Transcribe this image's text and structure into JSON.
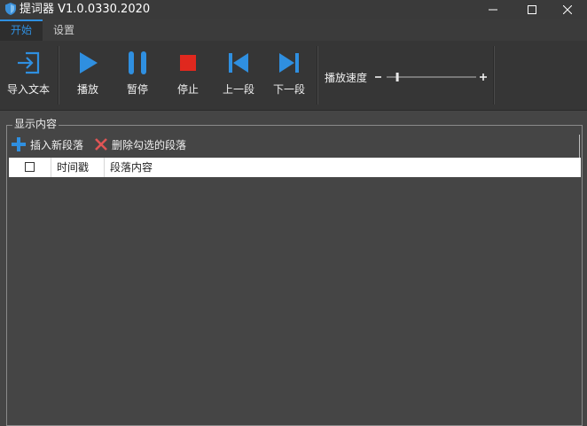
{
  "window": {
    "title": "提词器 V1.0.0330.2020",
    "icon": "shield-icon",
    "controls": [
      "minimize-icon",
      "maximize-icon",
      "close-icon"
    ]
  },
  "tabs": [
    {
      "label": "开始",
      "active": true
    },
    {
      "label": "设置",
      "active": false
    }
  ],
  "toolbar": {
    "import": {
      "label": "导入文本",
      "icon": "import-icon"
    },
    "play": {
      "label": "播放",
      "icon": "play-icon"
    },
    "pause": {
      "label": "暂停",
      "icon": "pause-icon"
    },
    "stop": {
      "label": "停止",
      "icon": "stop-icon"
    },
    "prev": {
      "label": "上一段",
      "icon": "skip-previous-icon"
    },
    "next": {
      "label": "下一段",
      "icon": "skip-next-icon"
    },
    "speed": {
      "label": "播放速度",
      "minus": "−",
      "plus": "+",
      "level": 0.12
    }
  },
  "content": {
    "legend": "显示内容",
    "insert_label": "插入新段落",
    "delete_label": "删除勾选的段落",
    "columns": {
      "timestamp": "时间戳",
      "paragraph": "段落内容"
    },
    "rows": []
  },
  "colors": {
    "accent": "#2f8fe0",
    "stop_red": "#e0281e",
    "background": "#454545",
    "toolbar": "#363636"
  }
}
